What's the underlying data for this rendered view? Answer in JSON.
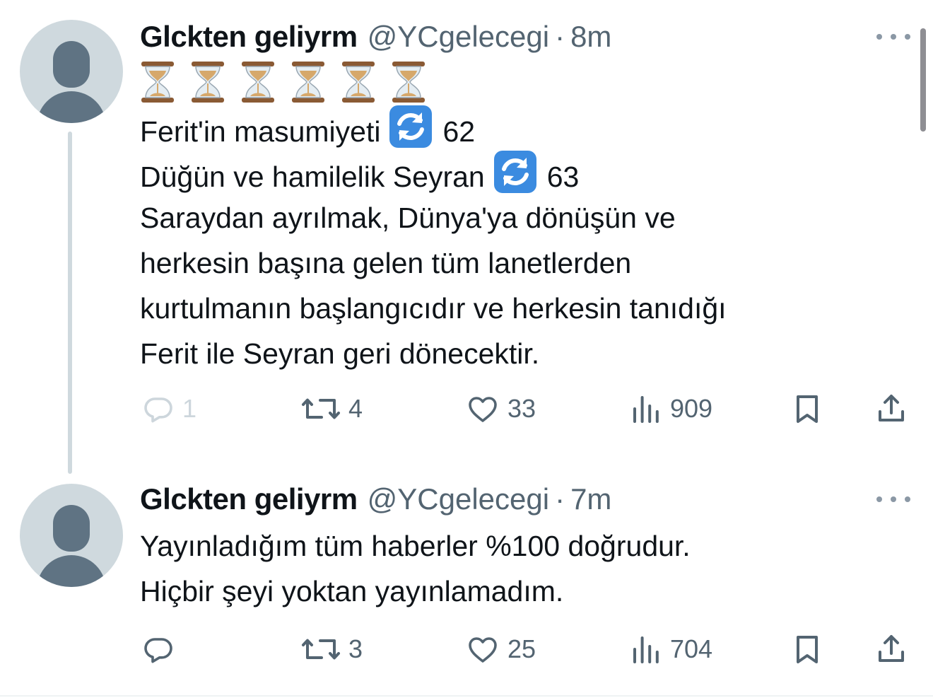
{
  "tweets": [
    {
      "display_name": "Glckten geliyrm",
      "handle": "@YCgelecegi",
      "separator": "·",
      "time": "8m",
      "emoji_row": "⌛⌛⌛⌛⌛⌛",
      "line1_pre": "Ferit'in masumiyeti",
      "line1_post": "62",
      "line2_pre": "Düğün ve hamilelik Seyran",
      "line2_post": "63",
      "line3": "Saraydan ayrılmak, Dünya'ya dönüşün ve",
      "line4": "herkesin başına gelen tüm lanetlerden",
      "line5": "kurtulmanın başlangıcıdır ve herkesin tanıdığı",
      "line6": "Ferit ile Seyran geri dönecektir.",
      "replies": "1",
      "retweets": "4",
      "likes": "33",
      "views": "909"
    },
    {
      "display_name": "Glckten geliyrm",
      "handle": "@YCgelecegi",
      "separator": "·",
      "time": "7m",
      "line1": "Yayınladığım tüm haberler %100 doğrudur.",
      "line2": "Hiçbir şeyi yoktan yayınlamadım.",
      "retweets": "3",
      "likes": "25",
      "views": "704"
    }
  ],
  "icons": {
    "hourglass": "hourglass-icon",
    "refresh": "refresh-emoji-icon",
    "reply": "reply-icon",
    "retweet": "retweet-icon",
    "like": "heart-icon",
    "views": "views-icon",
    "bookmark": "bookmark-icon",
    "share": "share-icon",
    "more": "more-icon"
  },
  "colors": {
    "text": "#0f1419",
    "secondary": "#536471",
    "thread_line": "#cfd9de",
    "avatar_bg": "#cfd9de",
    "avatar_fg": "#5f7383",
    "refresh_emoji": "#3b8be0"
  }
}
